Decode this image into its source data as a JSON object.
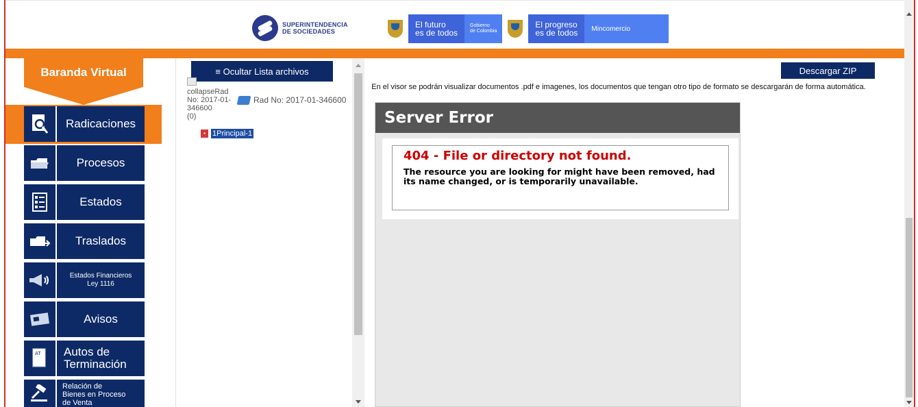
{
  "header": {
    "supersoc_line1": "SUPERINTENDENCIA",
    "supersoc_line2": "DE SOCIEDADES",
    "gov_futuro_1": "El futuro",
    "gov_futuro_2": "es de todos",
    "gov_gobierno_1": "Gobierno",
    "gov_gobierno_2": "de Colombia",
    "gov_progreso_1": "El progreso",
    "gov_progreso_2": "es de todos",
    "gov_mincomercio": "Mincomercio"
  },
  "sidebar": {
    "title": "Baranda Virtual",
    "items": [
      {
        "label": "Radicaciones",
        "icon": "search-document-icon"
      },
      {
        "label": "Procesos",
        "icon": "folder-icon"
      },
      {
        "label": "Estados",
        "icon": "checklist-icon"
      },
      {
        "label": "Traslados",
        "icon": "folder-transfer-icon"
      },
      {
        "label_1": "Estados Financieros",
        "label_2": "Ley 1116",
        "icon": "megaphone-icon"
      },
      {
        "label": "Avisos",
        "icon": "newspaper-icon"
      },
      {
        "label_1": "Autos de",
        "label_2": "Terminación",
        "icon": "document-at-icon"
      },
      {
        "label_1": "Relación de",
        "label_2": "Bienes en Proceso",
        "label_3": "de Venta",
        "icon": "gavel-icon"
      }
    ]
  },
  "filelist": {
    "hide_button": "≡ Ocultar Lista archivos",
    "collapse_alt": "collapseRad No: 2017-01-346600",
    "count": "(0)",
    "rad_label": "Rad No: 2017-01-346600",
    "file_name": "1Principal-1"
  },
  "viewer": {
    "download_zip": "Descargar ZIP",
    "note": "En el visor se podrán visualizar documentos .pdf e imagenes, los documentos que tengan otro tipo de formato se descargarán de forma automática.",
    "error_header": "Server Error",
    "error_title": "404 - File or directory not found.",
    "error_text": "The resource you are looking for might have been removed, had its name changed, or is temporarily unavailable."
  },
  "colors": {
    "brand_orange": "#f07f1c",
    "navy": "#0e2a66",
    "error_red": "#cc0000",
    "frame_red": "#d62b2b"
  }
}
